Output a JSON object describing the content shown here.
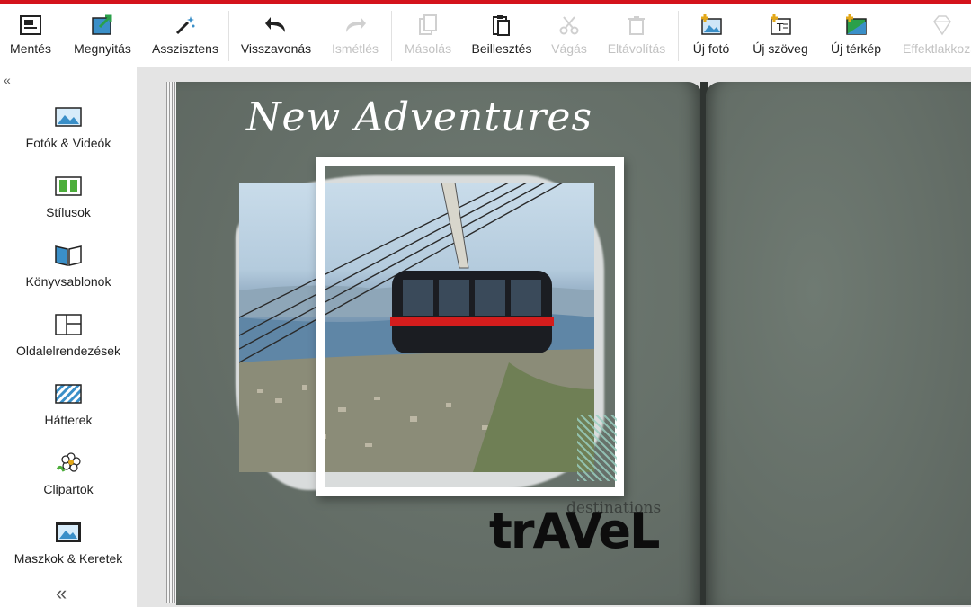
{
  "toolbar": {
    "save": "Mentés",
    "open": "Megnyitás",
    "assistant": "Asszisztens",
    "undo": "Visszavonás",
    "redo": "Ismétlés",
    "copy": "Másolás",
    "paste": "Beillesztés",
    "cut": "Vágás",
    "delete": "Eltávolítás",
    "new_photo": "Új fotó",
    "new_text": "Új szöveg",
    "new_map": "Új térkép",
    "effects": "Effektlakkoza"
  },
  "sidebar": {
    "items": [
      {
        "label": "Fotók & Videók",
        "icon": "photos-icon"
      },
      {
        "label": "Stílusok",
        "icon": "styles-icon"
      },
      {
        "label": "Könyvsablonok",
        "icon": "book-templates-icon"
      },
      {
        "label": "Oldalelrendezések",
        "icon": "layouts-icon"
      },
      {
        "label": "Hátterek",
        "icon": "backgrounds-icon"
      },
      {
        "label": "Clipartok",
        "icon": "clipart-icon"
      },
      {
        "label": "Maszkok & Keretek",
        "icon": "masks-frames-icon"
      }
    ]
  },
  "page": {
    "title": "New Adventures",
    "travel_small": "destinations",
    "travel_big": "trAVeL"
  },
  "colors": {
    "accent": "#d4131c",
    "page_bg": "#66706a",
    "disabled_text": "#c2c2c2"
  }
}
